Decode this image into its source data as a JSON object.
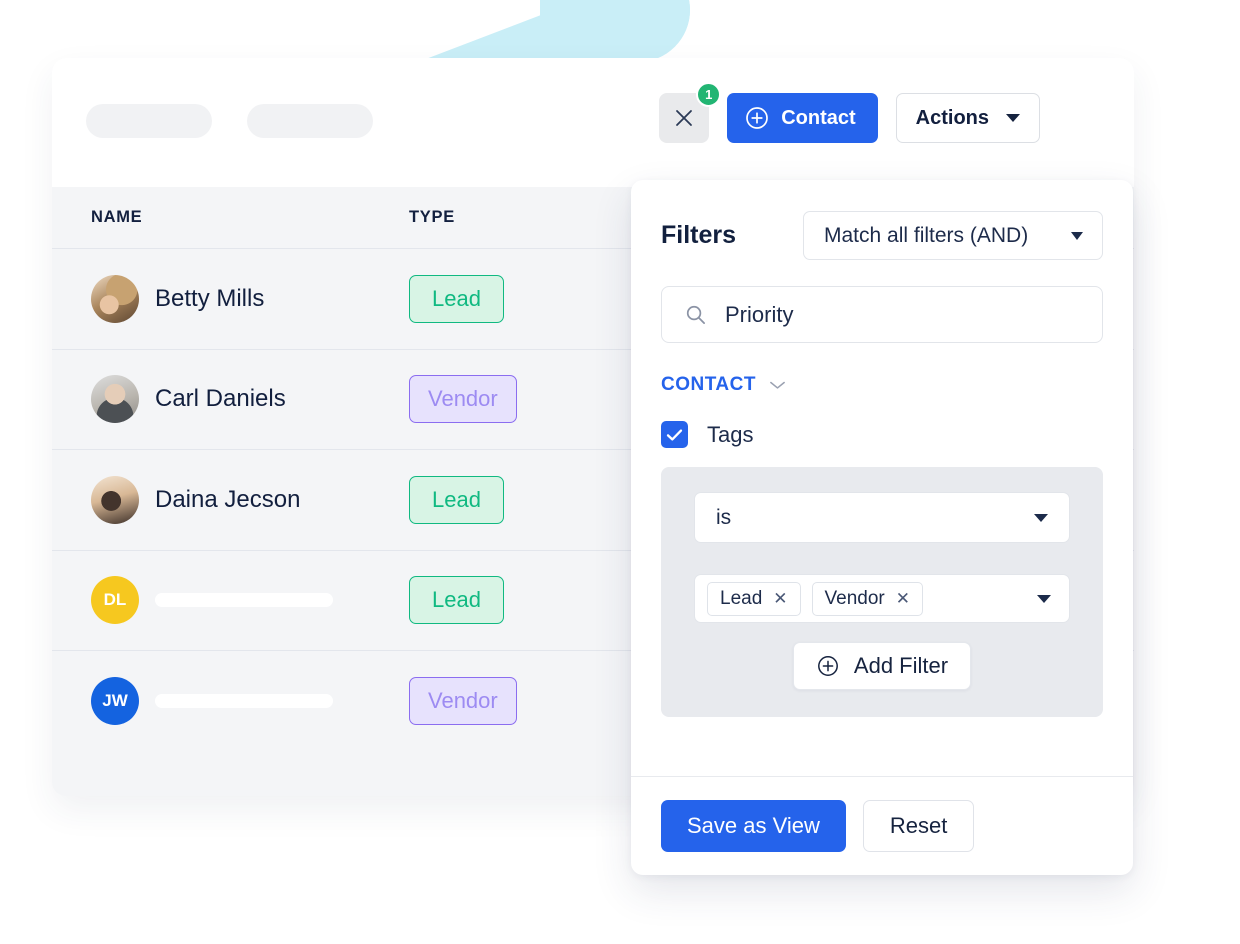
{
  "decor": {
    "wedge_color": "#c9eef7"
  },
  "toolbar": {
    "close_icon": "close-icon",
    "badge_count": "1",
    "contact_label": "Contact",
    "contact_icon": "plus-circle-icon",
    "actions_label": "Actions",
    "actions_caret_icon": "caret-down-icon"
  },
  "table": {
    "columns": [
      "NAME",
      "TYPE"
    ],
    "rows": [
      {
        "name": "Betty Mills",
        "avatar_kind": "photo",
        "avatar_class": "ph1",
        "initials": "",
        "type": "Lead",
        "type_style": "lead"
      },
      {
        "name": "Carl Daniels",
        "avatar_kind": "photo",
        "avatar_class": "ph2",
        "initials": "",
        "type": "Vendor",
        "type_style": "vendor"
      },
      {
        "name": "Daina Jecson",
        "avatar_kind": "photo",
        "avatar_class": "ph3",
        "initials": "",
        "type": "Lead",
        "type_style": "lead"
      },
      {
        "name": "",
        "avatar_kind": "initials",
        "avatar_class": "yellow",
        "initials": "DL",
        "type": "Lead",
        "type_style": "lead"
      },
      {
        "name": "",
        "avatar_kind": "initials",
        "avatar_class": "blue",
        "initials": "JW",
        "type": "Vendor",
        "type_style": "vendor"
      }
    ]
  },
  "filters": {
    "title": "Filters",
    "match_mode": "Match all filters (AND)",
    "search_value": "Priority",
    "search_placeholder": "Priority",
    "search_icon": "search-icon",
    "group": {
      "label": "CONTACT",
      "chevron_icon": "chevron-down-icon"
    },
    "field": {
      "label": "Tags",
      "checked": true,
      "check_icon": "check-icon"
    },
    "operator": "is",
    "values": [
      "Lead",
      "Vendor"
    ],
    "remove_icon": "close-small-icon",
    "add_filter_label": "Add Filter",
    "add_filter_icon": "plus-circle-icon",
    "save_label": "Save as View",
    "reset_label": "Reset"
  },
  "colors": {
    "accent_blue": "#2563eb",
    "badge_green": "#22b573",
    "lead_green": "#10b981",
    "vendor_purple": "#8b6df0",
    "panel_gray": "#e8eaee",
    "card_gray": "#f4f5f7"
  }
}
